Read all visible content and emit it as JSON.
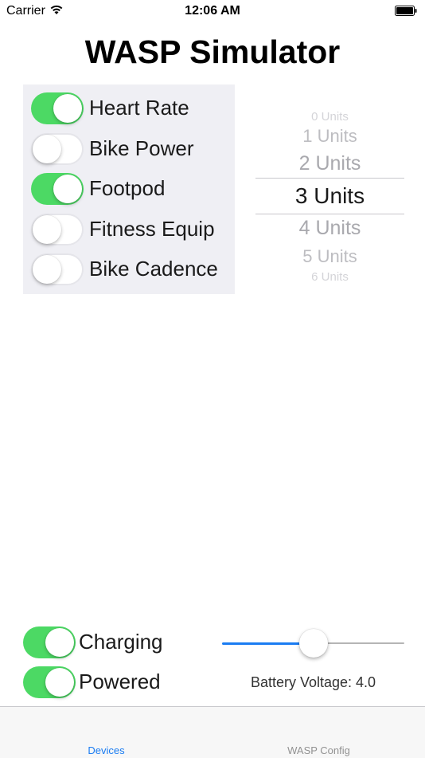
{
  "status_bar": {
    "carrier": "Carrier",
    "time": "12:06 AM"
  },
  "title": "WASP Simulator",
  "devices": [
    {
      "label": "Heart Rate",
      "on": true
    },
    {
      "label": "Bike Power",
      "on": false
    },
    {
      "label": "Footpod",
      "on": true
    },
    {
      "label": "Fitness Equip",
      "on": false
    },
    {
      "label": "Bike Cadence",
      "on": false
    }
  ],
  "picker": {
    "items": [
      "0 Units",
      "1 Units",
      "2 Units",
      "3 Units",
      "4 Units",
      "5 Units",
      "6 Units"
    ],
    "selected_index": 3
  },
  "charging": {
    "label": "Charging",
    "on": true
  },
  "powered": {
    "label": "Powered",
    "on": true
  },
  "battery_slider": {
    "fraction": 0.5
  },
  "battery_voltage_text": "Battery Voltage: 4.0",
  "tabs": [
    {
      "label": "Devices",
      "selected": true
    },
    {
      "label": "WASP Config",
      "selected": false
    }
  ],
  "colors": {
    "toggle_on": "#4cd964",
    "tab_selected": "#1a7cf2",
    "tab_unselected": "#929292",
    "slider_min": "#1a7cf2"
  },
  "icons": {
    "wifi": "wifi-icon",
    "battery": "battery-icon"
  }
}
